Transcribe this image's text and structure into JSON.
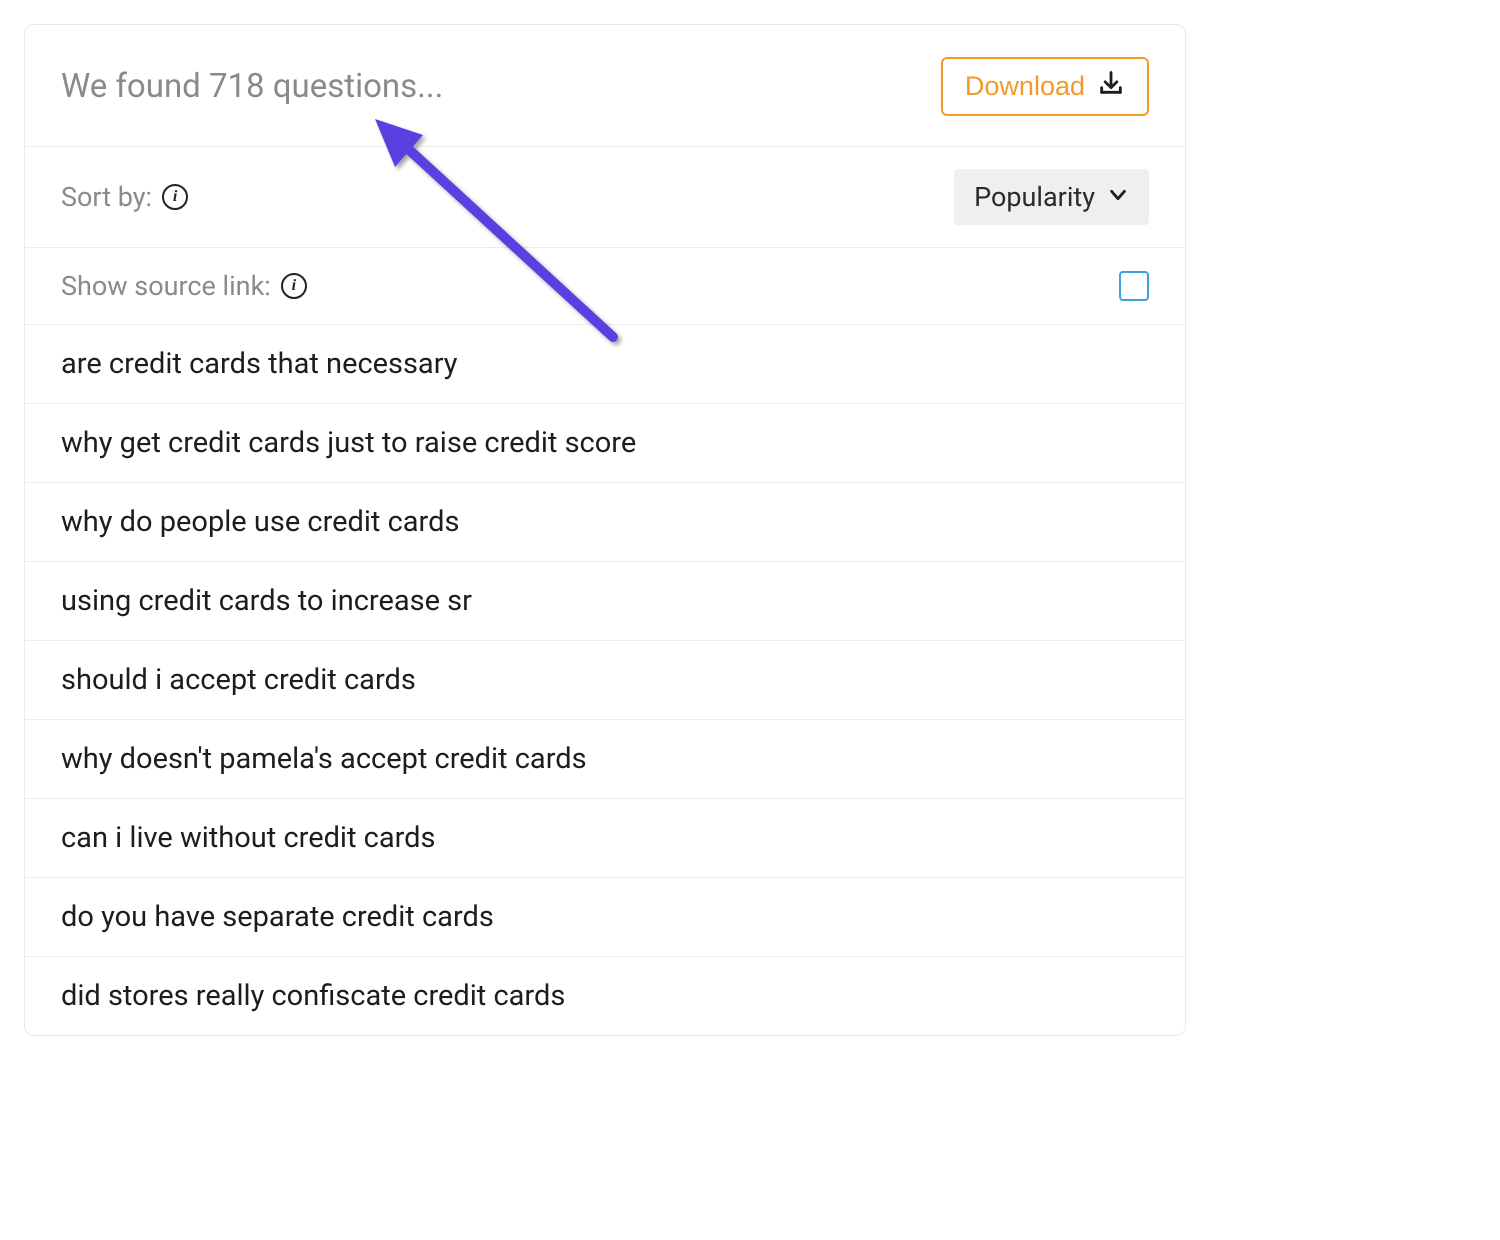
{
  "header": {
    "title": "We found 718 questions...",
    "download_label": "Download"
  },
  "sort": {
    "label": "Sort by:",
    "selected": "Popularity"
  },
  "source_link": {
    "label": "Show source link:",
    "checked": false
  },
  "questions": [
    "are credit cards that necessary",
    "why get credit cards just to raise credit score",
    "why do people use credit cards",
    "using credit cards to increase sr",
    "should i accept credit cards",
    "why doesn't pamela's accept credit cards",
    "can i live without credit cards",
    "do you have separate credit cards",
    "did stores really confiscate credit cards"
  ]
}
